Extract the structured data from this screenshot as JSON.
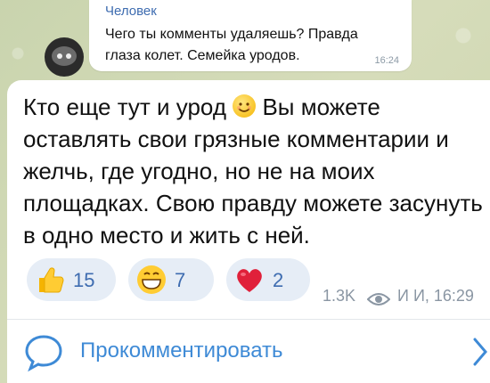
{
  "reply": {
    "author": "Человек",
    "line1": "Чего ты комменты удаляешь? Правда",
    "line2": "глаза колет. Семейка уродов.",
    "time": "16:24"
  },
  "message": {
    "part1": "Кто еще тут и урод ",
    "emoji_icon": "smiling-face-icon",
    "part2": " Вы можете оставлять свои грязные комментарии и желчь, где угодно, но не на моих площадках. Свою правду можете засунуть в одно место и жить с ней."
  },
  "reactions": [
    {
      "icon": "thumbs-up-icon",
      "count": "15"
    },
    {
      "icon": "grinning-face-icon",
      "count": "7"
    },
    {
      "icon": "red-heart-icon",
      "count": "2"
    }
  ],
  "meta": {
    "views": "1.3K",
    "signature_time": "И И, 16:29"
  },
  "comment": {
    "label": "Прокомментировать"
  },
  "colors": {
    "accent": "#3e8ad6",
    "name": "#3e6cb0",
    "reaction_bg": "#e6edf6",
    "meta": "#8a96a3"
  }
}
